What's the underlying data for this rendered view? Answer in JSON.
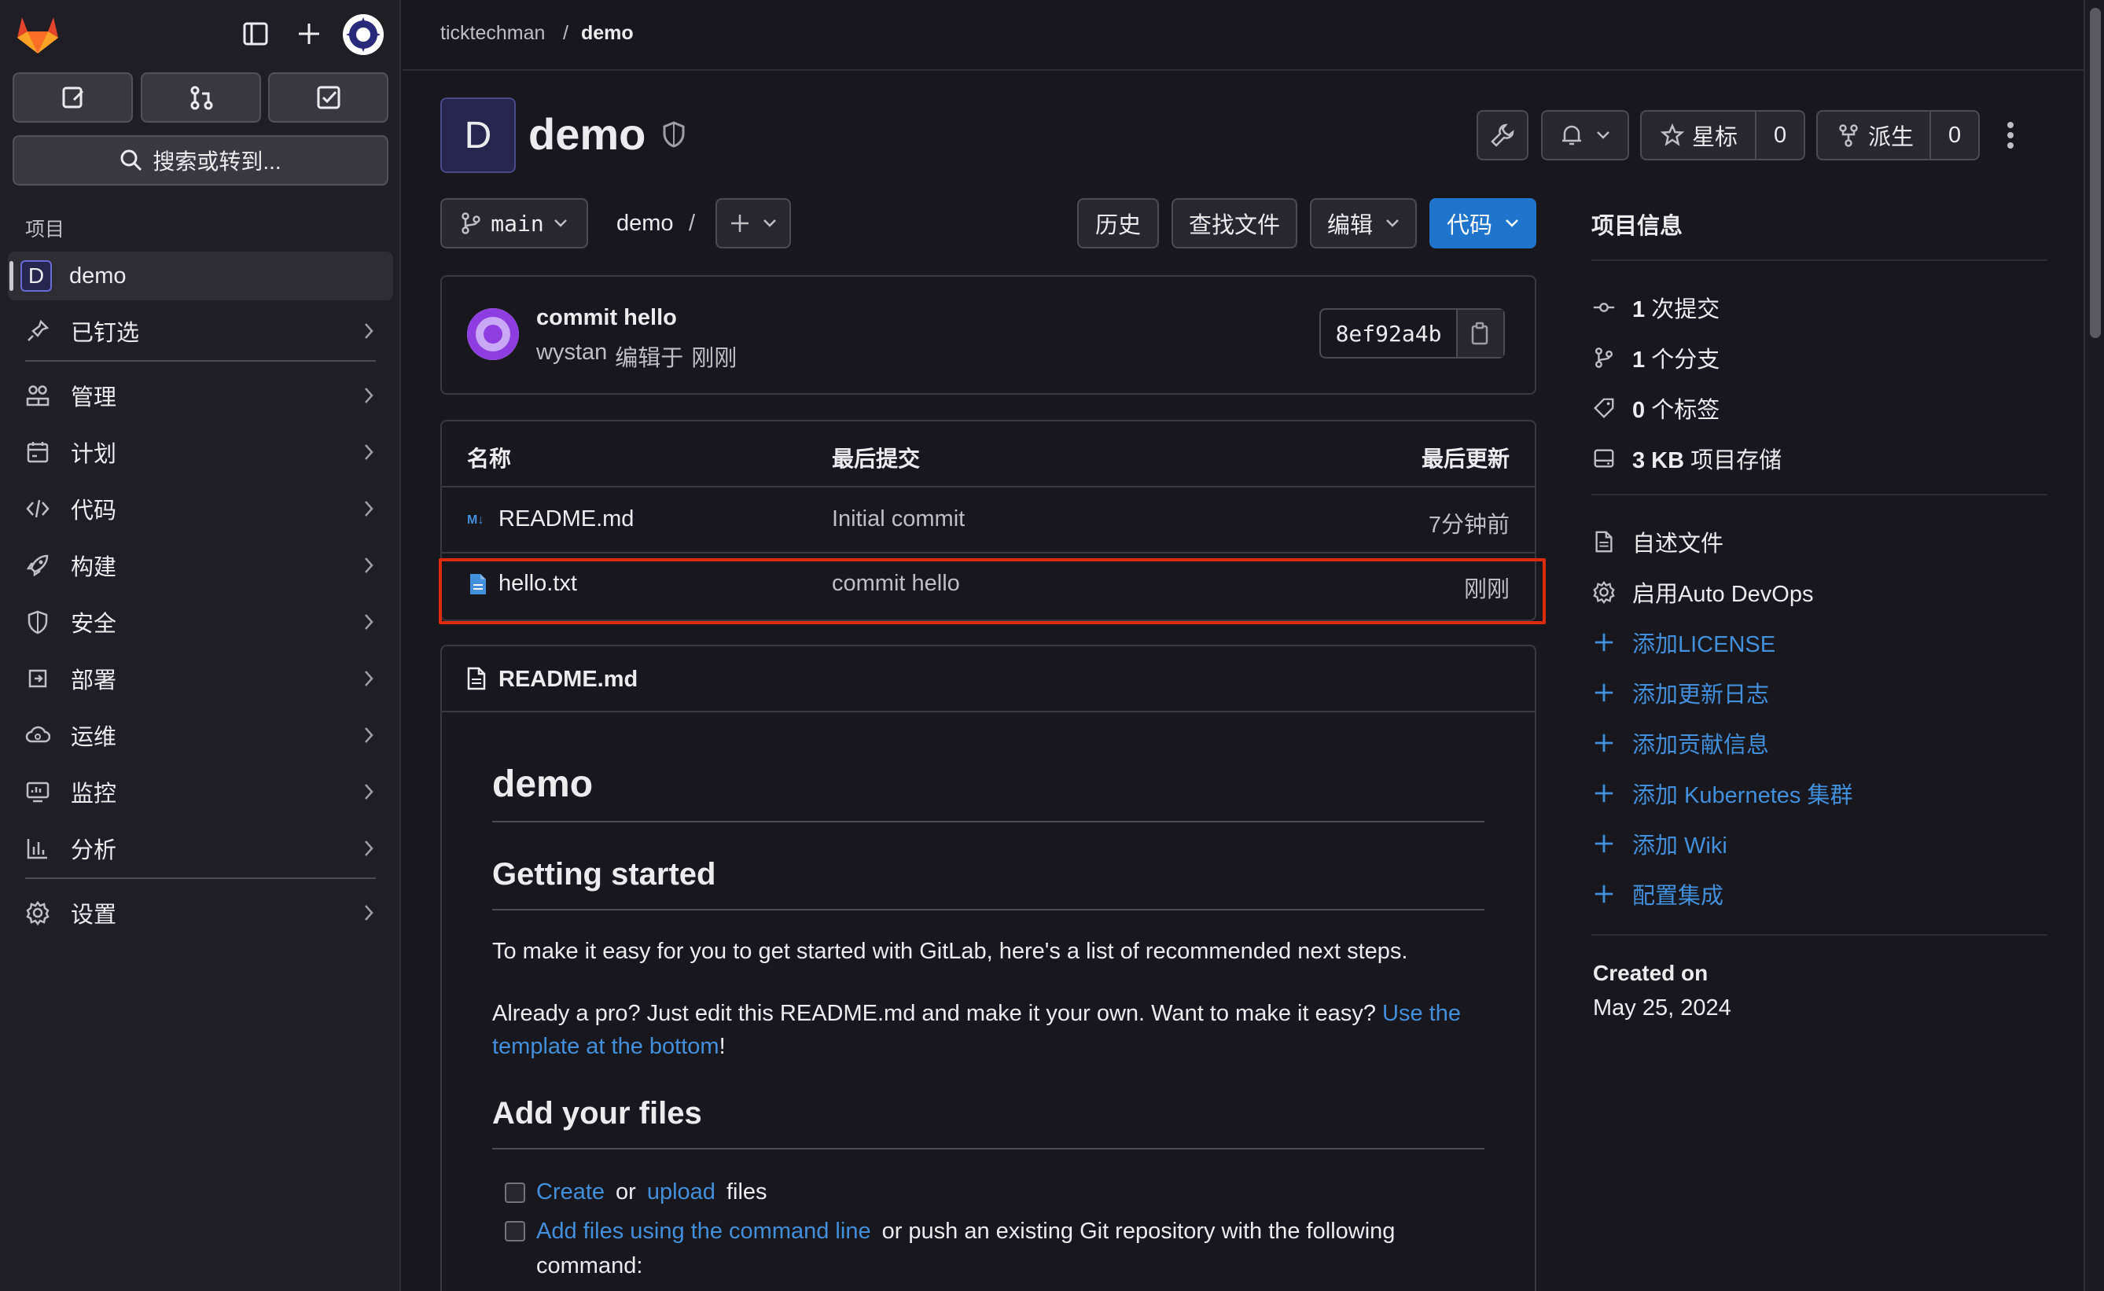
{
  "sidebar": {
    "section_label": "项目",
    "search_label": "搜索或转到...",
    "project": {
      "avatar": "D",
      "name": "demo"
    },
    "items": [
      {
        "label": "已钉选",
        "icon": "pin-icon"
      },
      {
        "label": "管理",
        "icon": "users-icon"
      },
      {
        "label": "计划",
        "icon": "calendar-icon"
      },
      {
        "label": "代码",
        "icon": "code-icon"
      },
      {
        "label": "构建",
        "icon": "rocket-icon"
      },
      {
        "label": "安全",
        "icon": "shield-icon"
      },
      {
        "label": "部署",
        "icon": "deployments-icon"
      },
      {
        "label": "运维",
        "icon": "cloud-gear-icon"
      },
      {
        "label": "监控",
        "icon": "monitor-icon"
      },
      {
        "label": "分析",
        "icon": "chart-icon"
      },
      {
        "label": "设置",
        "icon": "settings-icon"
      }
    ]
  },
  "breadcrumb": {
    "group": "ticktechman",
    "separator": "/",
    "project": "demo"
  },
  "project": {
    "avatar": "D",
    "title": "demo",
    "star_label": "星标",
    "star_count": "0",
    "fork_label": "派生",
    "fork_count": "0"
  },
  "toolbar": {
    "branch": "main",
    "path": "demo",
    "path_sep": "/",
    "history": "历史",
    "find_file": "查找文件",
    "edit": "编辑",
    "code": "代码"
  },
  "commit": {
    "message": "commit hello",
    "author": "wystan",
    "action": "编辑于",
    "time": "刚刚",
    "sha": "8ef92a4b"
  },
  "file_table": {
    "headers": {
      "name": "名称",
      "last_commit": "最后提交",
      "last_update": "最后更新"
    },
    "rows": [
      {
        "name": "README.md",
        "commit": "Initial commit",
        "updated": "7分钟前",
        "icon": "markdown-icon"
      },
      {
        "name": "hello.txt",
        "commit": "commit hello",
        "updated": "刚刚",
        "icon": "file-icon"
      }
    ],
    "highlight_color": "#dd2b0e"
  },
  "readme": {
    "filename": "README.md",
    "h1": "demo",
    "h2_getting_started": "Getting started",
    "p1": "To make it easy for you to get started with GitLab, here's a list of recommended next steps.",
    "p2_text": "Already a pro? Just edit this README.md and make it your own. Want to make it easy?",
    "p2_link_line1": "Use the",
    "p2_link_line2": "template at the bottom",
    "p2_end": "!",
    "h2_add_files": "Add your files",
    "task1": {
      "link1": "Create",
      "or": "or",
      "link2": "upload",
      "rest": "files"
    },
    "task2": {
      "link": "Add files using the command line",
      "rest": "or push an existing Git repository with the following",
      "rest2": "command:"
    }
  },
  "project_info": {
    "title": "项目信息",
    "stats": [
      {
        "bold": "1",
        "text": "次提交",
        "icon": "commit-icon"
      },
      {
        "bold": "1",
        "text": "个分支",
        "icon": "branch-icon"
      },
      {
        "bold": "0",
        "text": "个标签",
        "icon": "label-icon"
      },
      {
        "bold": "3 KB",
        "text": "项目存储",
        "icon": "disk-icon"
      }
    ],
    "links": [
      {
        "label": "自述文件",
        "icon": "document-icon",
        "style": "plain"
      },
      {
        "label": "启用Auto DevOps",
        "icon": "settings-icon",
        "style": "plain"
      },
      {
        "label": "添加LICENSE",
        "icon": "plus-icon",
        "style": "link"
      },
      {
        "label": "添加更新日志",
        "icon": "plus-icon",
        "style": "link"
      },
      {
        "label": "添加贡献信息",
        "icon": "plus-icon",
        "style": "link"
      },
      {
        "label": "添加 Kubernetes 集群",
        "icon": "plus-icon",
        "style": "link"
      },
      {
        "label": "添加 Wiki",
        "icon": "plus-icon",
        "style": "link"
      },
      {
        "label": "配置集成",
        "icon": "plus-icon",
        "style": "link"
      }
    ],
    "created_label": "Created on",
    "created_date": "May 25, 2024"
  },
  "colors": {
    "accent": "#1f75cb",
    "link": "#428fdc",
    "gitlab_orange": "#fc6d26"
  }
}
